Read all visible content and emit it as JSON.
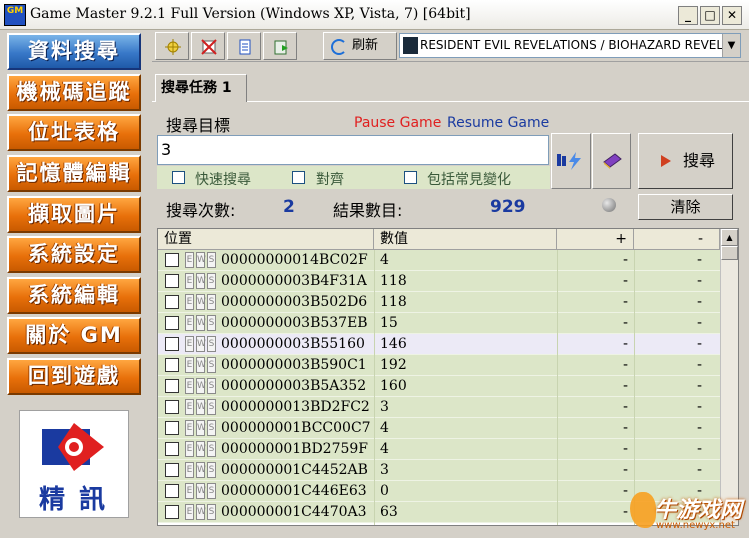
{
  "window": {
    "title": "Game Master 9.2.1 Full Version (Windows XP, Vista, 7) [64bit]",
    "icon_label": "GM",
    "minimize": "_",
    "maximize": "□",
    "close": "✕"
  },
  "sidebar": {
    "items": [
      {
        "label": "資料搜尋",
        "active": true
      },
      {
        "label": "機械碼追蹤"
      },
      {
        "label": "位址表格"
      },
      {
        "label": "記憶體編輯"
      },
      {
        "label": "擷取圖片"
      },
      {
        "label": "系統設定"
      },
      {
        "label": "系統編輯"
      },
      {
        "label": "關於 GM"
      },
      {
        "label": "回到遊戲"
      }
    ],
    "logo_text": "精訊"
  },
  "toolbar": {
    "refresh_label": "刷新",
    "process": "RESIDENT EVIL REVELATIONS / BIOHAZARD REVELA"
  },
  "tab": {
    "label": "搜尋任務 1"
  },
  "search": {
    "label": "搜尋目標",
    "pause": "Pause Game",
    "resume": "Resume Game",
    "value": "3",
    "options": [
      "快速搜尋",
      "對齊",
      "包括常見變化"
    ],
    "scan_label": "搜尋"
  },
  "stats": {
    "search_count_label": "搜尋次數:",
    "search_count": "2",
    "result_count_label": "結果數目:",
    "result_count": "929",
    "clear_label": "清除"
  },
  "table": {
    "headers": [
      "位置",
      "數值",
      "+",
      "-"
    ],
    "rows": [
      {
        "addr": "00000000014BC02F",
        "value": "4",
        "plus": "-",
        "minus": "-"
      },
      {
        "addr": "0000000003B4F31A",
        "value": "118",
        "plus": "-",
        "minus": "-"
      },
      {
        "addr": "0000000003B502D6",
        "value": "118",
        "plus": "-",
        "minus": "-"
      },
      {
        "addr": "0000000003B537EB",
        "value": "15",
        "plus": "-",
        "minus": "-"
      },
      {
        "addr": "0000000003B55160",
        "value": "146",
        "plus": "-",
        "minus": "-",
        "selected": true
      },
      {
        "addr": "0000000003B590C1",
        "value": "192",
        "plus": "-",
        "minus": "-"
      },
      {
        "addr": "0000000003B5A352",
        "value": "160",
        "plus": "-",
        "minus": "-"
      },
      {
        "addr": "0000000013BD2FC2",
        "value": "3",
        "plus": "-",
        "minus": "-"
      },
      {
        "addr": "000000001BCC00C7",
        "value": "4",
        "plus": "-",
        "minus": "-"
      },
      {
        "addr": "000000001BD2759F",
        "value": "4",
        "plus": "-",
        "minus": "-"
      },
      {
        "addr": "000000001C4452AB",
        "value": "3",
        "plus": "-",
        "minus": "-"
      },
      {
        "addr": "000000001C446E63",
        "value": "0",
        "plus": "-",
        "minus": "-"
      },
      {
        "addr": "000000001C4470A3",
        "value": "63",
        "plus": "-",
        "minus": "-"
      }
    ],
    "flags": [
      "E",
      "W",
      "S"
    ]
  },
  "watermark": {
    "main": "牛游戏网",
    "sub": "www.newyx.net"
  },
  "colors": {
    "nav_orange": "#e8700a",
    "nav_active": "#3878c8",
    "pause": "#e02020",
    "resume": "#1a3aa0",
    "row_bg": "#dce6c8"
  }
}
